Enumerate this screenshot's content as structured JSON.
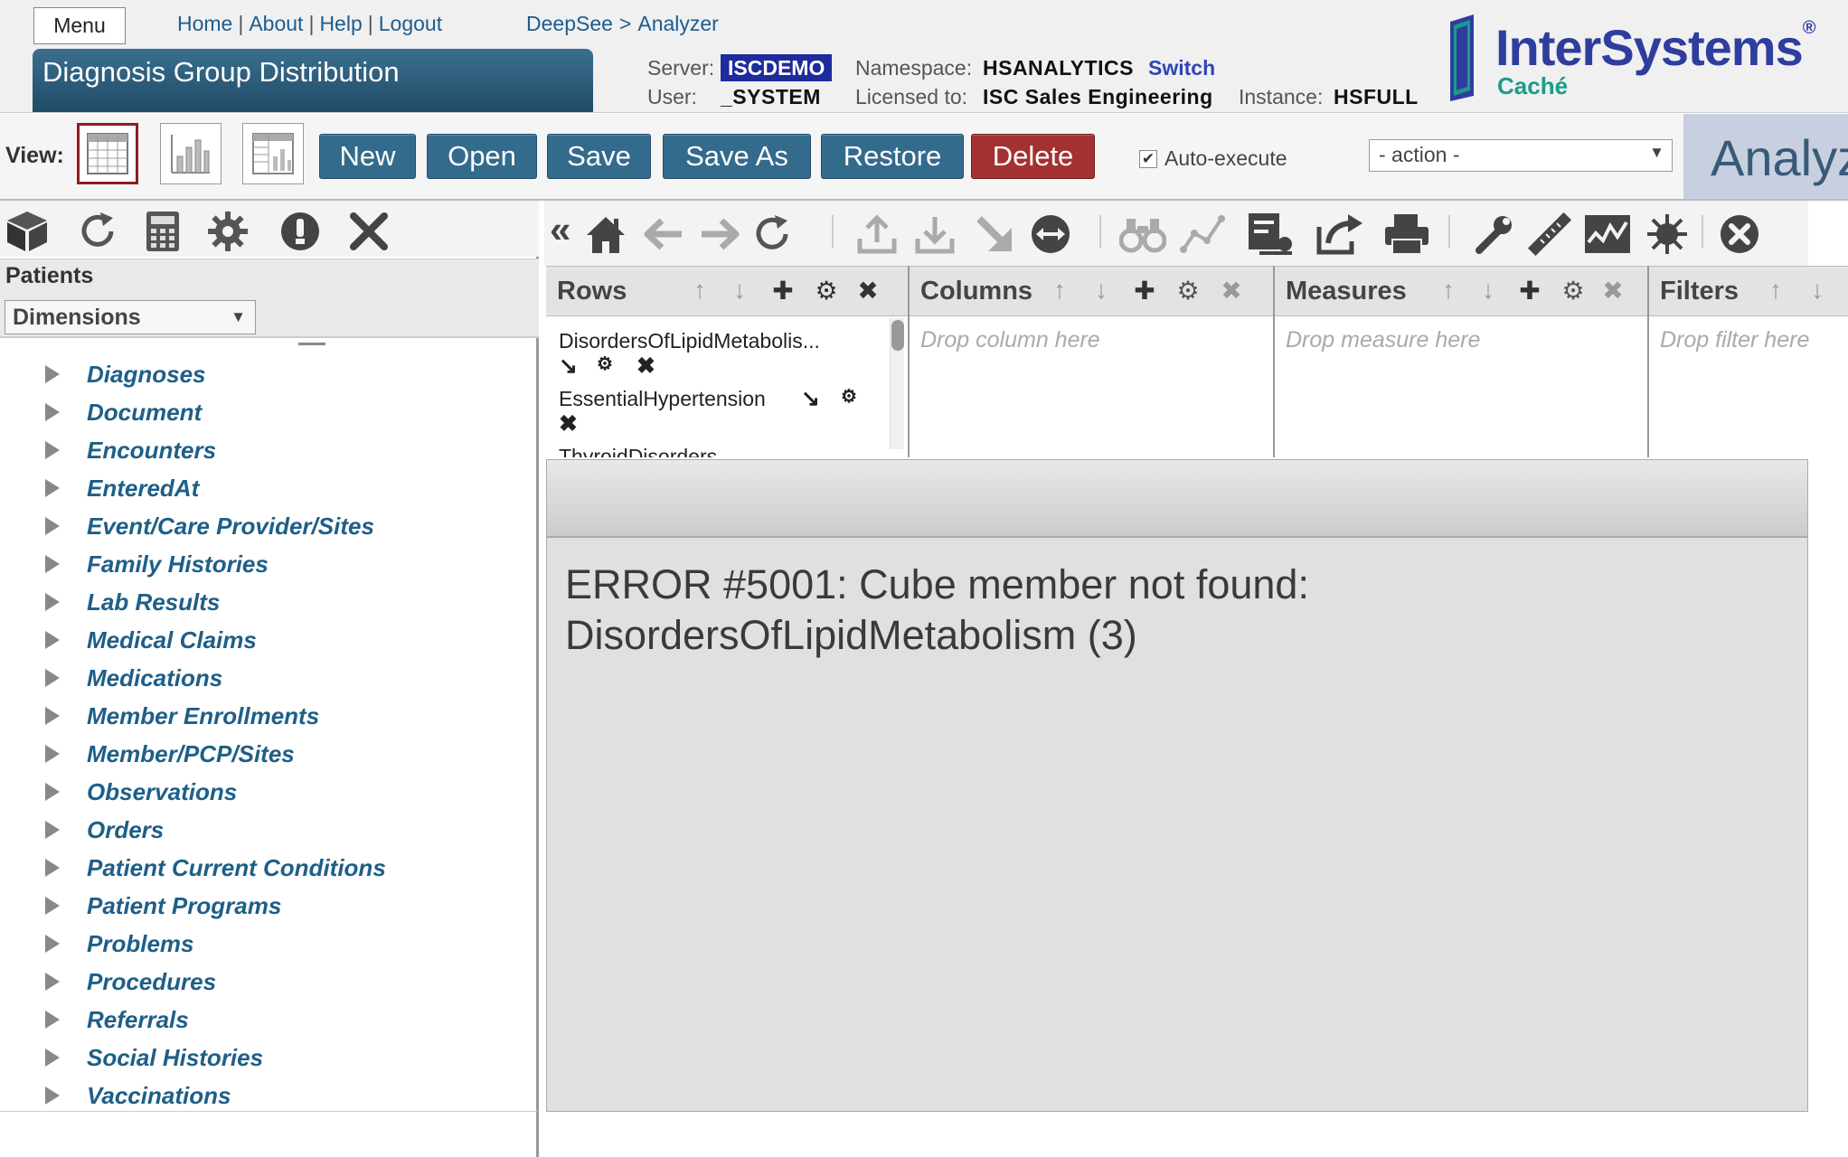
{
  "header": {
    "menu_label": "Menu",
    "links": [
      "Home",
      "About",
      "Help",
      "Logout"
    ],
    "link_separator": "|",
    "breadcrumb": [
      "DeepSee",
      "Analyzer"
    ],
    "breadcrumb_separator": ">",
    "page_title": "Diagnosis Group Distribution",
    "server_label": "Server:",
    "server_value": "ISCDEMO",
    "user_label": "User:",
    "user_value": "_SYSTEM",
    "namespace_label": "Namespace:",
    "namespace_value": "HSANALYTICS",
    "switch_label": "Switch",
    "licensed_label": "Licensed to:",
    "licensed_value": "ISC Sales Engineering",
    "instance_label": "Instance:",
    "instance_value": "HSFULL",
    "logo_text": "InterSystems",
    "logo_reg": "®",
    "logo_sub": "Caché"
  },
  "toolbar": {
    "view_label": "View:",
    "view_modes": [
      "table-view-icon",
      "chart-view-icon",
      "combined-view-icon"
    ],
    "buttons": [
      "New",
      "Open",
      "Save",
      "Save As",
      "Restore",
      "Delete"
    ],
    "auto_execute_label": "Auto-execute",
    "auto_execute_checked": true,
    "action_select": "- action -",
    "banner_text": "Analyzer"
  },
  "left_panel": {
    "icons": [
      "cube-icon",
      "refresh-icon",
      "calculator-icon",
      "gear-icon",
      "info-icon",
      "close-icon"
    ],
    "subject_label": "Patients",
    "dimensions_select": "Dimensions",
    "tree_items": [
      "Diagnoses",
      "Document",
      "Encounters",
      "EnteredAt",
      "Event/Care Provider/Sites",
      "Family Histories",
      "Lab Results",
      "Medical Claims",
      "Medications",
      "Member Enrollments",
      "Member/PCP/Sites",
      "Observations",
      "Orders",
      "Patient Current Conditions",
      "Patient Programs",
      "Problems",
      "Procedures",
      "Referrals",
      "Social Histories",
      "Vaccinations"
    ]
  },
  "right_panel": {
    "icons": [
      "home-icon",
      "back-arrow-icon",
      "forward-arrow-icon",
      "refresh-icon",
      "upload-icon",
      "download-icon",
      "drilldown-arrow-icon",
      "swap-icon",
      "binoculars-icon",
      "trend-line-icon",
      "pivot-options-icon",
      "share-icon",
      "print-icon",
      "wrench-icon",
      "ruler-icon",
      "chart-icon",
      "sun-icon",
      "close-circle-icon"
    ],
    "drop_zones": {
      "rows": {
        "title": "Rows",
        "items": [
          "DisordersOfLipidMetabolis...",
          "EssentialHypertension",
          "ThyroidDisorders"
        ]
      },
      "columns": {
        "title": "Columns",
        "placeholder": "Drop column here"
      },
      "measures": {
        "title": "Measures",
        "placeholder": "Drop measure here"
      },
      "filters": {
        "title": "Filters",
        "placeholder": "Drop filter here"
      }
    },
    "error_message": "ERROR #5001: Cube member not found: DisordersOfLipidMetabolism (3)"
  }
}
